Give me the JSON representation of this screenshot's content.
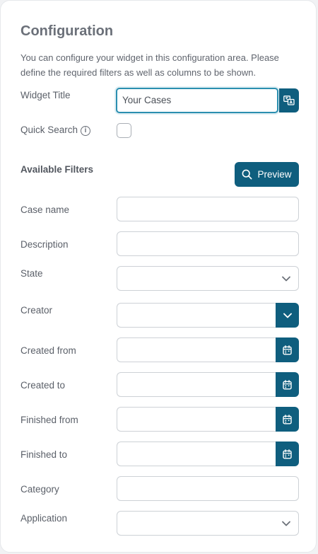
{
  "config": {
    "title": "Configuration",
    "description": "You can configure your widget in this configuration area. Please define the required filters as well as columns to be shown.",
    "widget_title_label": "Widget Title",
    "widget_title_value": "Your Cases",
    "quick_search_label": "Quick Search",
    "quick_search_checked": false,
    "info_glyph": "i"
  },
  "filters": {
    "section_label": "Available Filters",
    "preview_label": "Preview",
    "case_name_label": "Case name",
    "description_label": "Description",
    "state_label": "State",
    "creator_label": "Creator",
    "created_from_label": "Created from",
    "created_to_label": "Created to",
    "finished_from_label": "Finished from",
    "finished_to_label": "Finished to",
    "category_label": "Category",
    "application_label": "Application"
  },
  "colors": {
    "accent": "#0f5e7e",
    "focus_border": "#2b8fb0",
    "card_bg": "#ffffff",
    "page_bg": "#f1f2f4"
  },
  "icons": {
    "translate": "translate-icon",
    "info": "info-icon",
    "search": "search-icon",
    "chevron": "chevron-down-icon",
    "calendar": "calendar-icon"
  }
}
